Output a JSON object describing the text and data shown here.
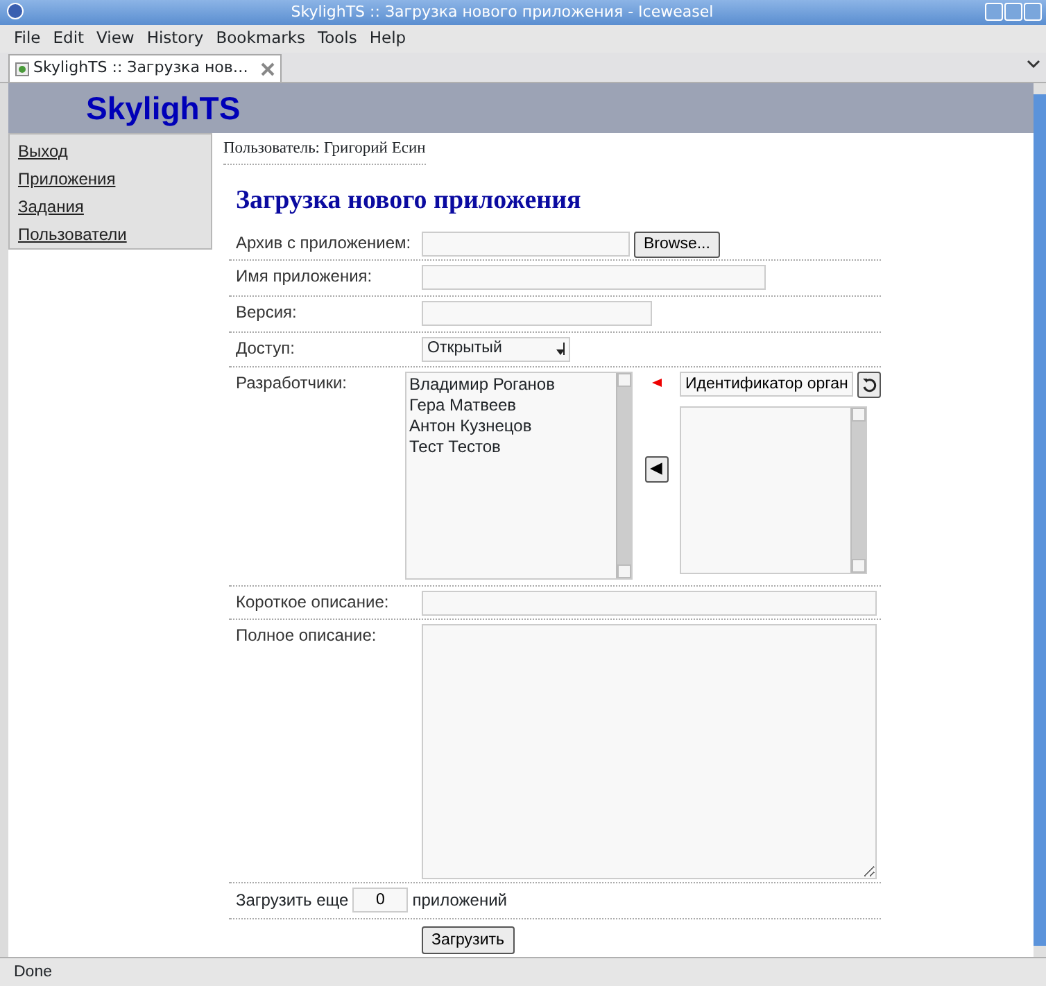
{
  "window": {
    "title": "SkylighTS :: Загрузка нового приложения - Iceweasel"
  },
  "menu": [
    "File",
    "Edit",
    "View",
    "History",
    "Bookmarks",
    "Tools",
    "Help"
  ],
  "tabs": [
    {
      "label": "SkylighTS :: Загрузка нов…",
      "selected": true
    }
  ],
  "site": {
    "logo": "SkylighTS"
  },
  "sidebar": {
    "items": [
      "Выход",
      "Приложения",
      "Задания",
      "Пользователи"
    ]
  },
  "user_line": "Пользователь: Григорий Есин",
  "heading": "Загрузка нового приложения",
  "form": {
    "archive": {
      "label": "Архив с приложением:",
      "button": "Browse..."
    },
    "name": {
      "label": "Имя приложения:"
    },
    "version": {
      "label": "Версия:"
    },
    "access": {
      "label": "Доступ:",
      "value": "Открытый"
    },
    "developers": {
      "label": "Разработчики:",
      "items": [
        "Владимир Роганов",
        "Гера Матвеев",
        "Антон Кузнецов",
        "Тест Тестов"
      ],
      "search_value": "Идентификатор орган",
      "move_button": "◀"
    },
    "short_description": {
      "label": "Короткое описание:"
    },
    "full_description": {
      "label": "Полное описание:"
    },
    "more": {
      "before": "Загрузить еще",
      "value": "0",
      "after": "приложений"
    },
    "submit": "Загрузить"
  },
  "status_bar": "Done"
}
